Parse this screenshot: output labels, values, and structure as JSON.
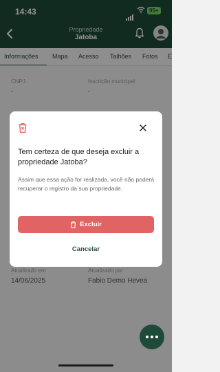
{
  "status_bar": {
    "time": "14:43",
    "battery": "95+"
  },
  "header": {
    "subtitle": "Propriedade",
    "title": "Jatoba"
  },
  "tabs": [
    {
      "label": "Informações",
      "active": true
    },
    {
      "label": "Mapa"
    },
    {
      "label": "Acesso"
    },
    {
      "label": "Talhões"
    },
    {
      "label": "Fotos"
    },
    {
      "label": "E"
    }
  ],
  "fields": {
    "cnpj": {
      "label": "CNPJ",
      "value": "-"
    },
    "inscricao": {
      "label": "Inscrição municipal",
      "value": "-"
    },
    "updated_at": {
      "label": "Atualizado em",
      "value": "14/06/2025"
    },
    "updated_by": {
      "label": "Atualizado por",
      "value": "Fabio Demo Hevea"
    }
  },
  "modal": {
    "title": "Tem certeza de que deseja excluir a propriedade Jatoba?",
    "body": "Assim que essa ação for realizada, você não poderá recuperar o registro da sua propriedade.",
    "delete_label": "Excluir",
    "cancel_label": "Cancelar"
  },
  "colors": {
    "header": "#1f4a3a",
    "danger": "#e06463",
    "accent": "#2f5e47"
  },
  "icons": [
    "back-arrow-icon",
    "bell-icon",
    "avatar",
    "trash-icon",
    "close-icon",
    "more-dots-icon"
  ]
}
